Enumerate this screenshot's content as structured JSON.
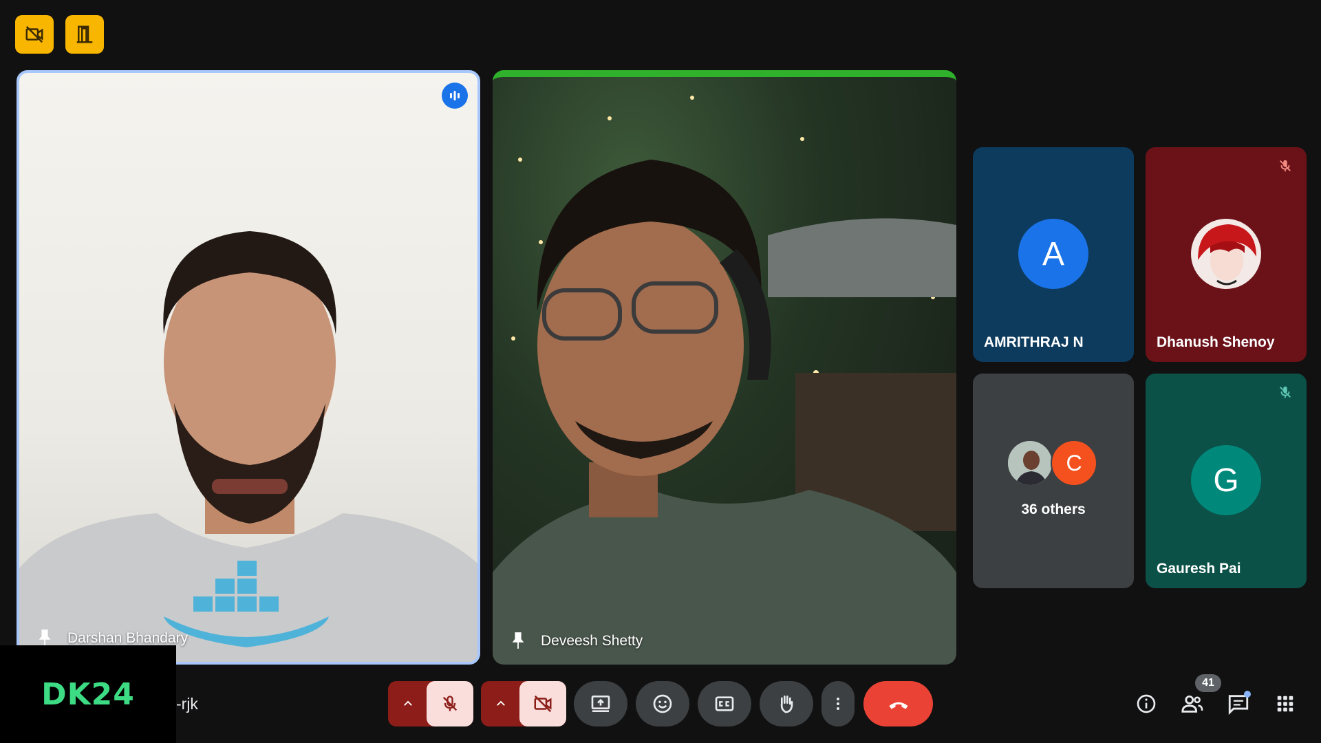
{
  "top_buttons": [
    {
      "icon": "no-camera-icon"
    },
    {
      "icon": "door-exit-icon"
    }
  ],
  "participants": {
    "darshan": {
      "name": "Darshan Bhandary",
      "icon": "pin-icon",
      "speaking_icon": "audio-level-icon"
    },
    "deveesh": {
      "name": "Deveesh Shetty",
      "icon": "pin-icon"
    },
    "amrithraj": {
      "name": "AMRITHRAJ N",
      "initial": "A",
      "color": "#1a73e8",
      "tile_color": "#0d3b5e"
    },
    "dhanush": {
      "name": "Dhanush Shenoy",
      "muted": true,
      "tile_color": "#6b1219"
    },
    "others": {
      "label": "36 others",
      "initial": "C",
      "color": "#f4511e",
      "tile_color": "#3c4043"
    },
    "gauresh": {
      "name": "Gauresh Pai",
      "initial": "G",
      "color": "#00897b",
      "muted": true,
      "tile_color": "#0b5148"
    }
  },
  "brand": {
    "logo": "DK24"
  },
  "meeting": {
    "code_suffix": "-rjk"
  },
  "toolbar": {
    "mic": {
      "icon": "mic-off-icon",
      "state": "off"
    },
    "camera": {
      "icon": "camera-off-icon",
      "state": "off"
    },
    "present": {
      "icon": "present-screen-icon"
    },
    "reactions": {
      "icon": "emoji-icon"
    },
    "captions": {
      "icon": "captions-icon"
    },
    "raise_hand": {
      "icon": "hand-icon"
    },
    "more": {
      "icon": "more-vert-icon"
    },
    "leave": {
      "icon": "end-call-icon",
      "color": "#ea4335"
    }
  },
  "right_controls": {
    "info": {
      "icon": "info-icon"
    },
    "people": {
      "icon": "people-icon",
      "count": "41"
    },
    "chat": {
      "icon": "chat-icon",
      "has_unread": true
    },
    "activities": {
      "icon": "apps-grid-icon"
    }
  },
  "colors": {
    "accent_yellow": "#f9b600",
    "speaking_border": "#a8c7fa",
    "danger": "#ea4335",
    "danger_dark": "#8c1d18",
    "danger_light": "#f9dedc"
  }
}
